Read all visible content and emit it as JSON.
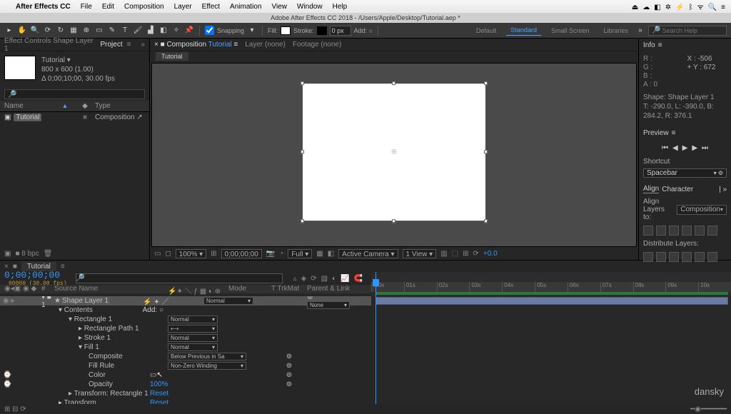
{
  "mac_menu": {
    "app": "After Effects CC",
    "items": [
      "File",
      "Edit",
      "Composition",
      "Layer",
      "Effect",
      "Animation",
      "View",
      "Window",
      "Help"
    ],
    "right": [
      "⏏",
      "☁",
      "◧",
      "⎋",
      "⚡",
      "≡",
      "⏱",
      "✎",
      "🔍",
      "🔊",
      "ᯤ",
      "◧",
      "≡"
    ]
  },
  "window_title": "Adobe After Effects CC 2018 - /Users/Apple/Desktop/Tutorial.aep *",
  "toolbar": {
    "snapping": "Snapping",
    "fill": "Fill:",
    "stroke": "Stroke:",
    "stroke_px": "0 px",
    "add": "Add: ○",
    "workspaces": [
      "Default",
      "Standard",
      "Small Screen",
      "Libraries"
    ],
    "ws_sel": 1,
    "search_ph": "Search Help"
  },
  "project": {
    "tabs": [
      "Effect Controls Shape Layer 1",
      "Project"
    ],
    "active": 1,
    "item_name": "Tutorial ▾",
    "res": "800 x 600 (1.00)",
    "dur": "Δ 0;00;10;00, 30.00 fps",
    "cols": [
      "Name",
      "◆",
      "Type"
    ],
    "row_name": "Tutorial",
    "row_type": "Composition",
    "footer": [
      "▣",
      "■",
      "8 bpc",
      "🗑"
    ]
  },
  "comp": {
    "tabs": [
      "× ■ Composition",
      "Tutorial",
      "Layer (none)",
      "Footage (none)"
    ],
    "comp_name": "Tutorial",
    "footer": {
      "zoom": "100%",
      "res": "Full",
      "time": "0;00;00;00",
      "camera": "Active Camera",
      "view": "1 View",
      "exp": "+0.0"
    }
  },
  "info": {
    "title": "Info",
    "R": "",
    "G": "",
    "B": "",
    "A": "0",
    "X": "-506",
    "Y": "672",
    "shape": "Shape: Shape Layer 1",
    "bounds": "T: -290.0, L: -390.0, B: 284.2, R: 376.1"
  },
  "preview": {
    "title": "Preview",
    "shortcut_lbl": "Shortcut",
    "shortcut": "Spacebar"
  },
  "align": {
    "tabs": [
      "Align",
      "Character"
    ],
    "layers_to": "Align Layers to:",
    "target": "Composition",
    "dist": "Distribute Layers:"
  },
  "timeline": {
    "tab": "Tutorial",
    "time": "0;00;00;00",
    "sub": "00000 (30.00 fps)",
    "cols": {
      "src": "Source Name",
      "mode": "Mode",
      "trk": "T  TrkMat",
      "parent": "Parent & Link"
    },
    "add": "Add: ○",
    "ruler": [
      ":00s",
      "01s",
      "02s",
      "03s",
      "04s",
      "05s",
      "06s",
      "07s",
      "08s",
      "09s",
      "10s"
    ],
    "layer": {
      "num": "1",
      "name": "Shape Layer 1",
      "mode": "Normal",
      "parent": "None"
    },
    "rows": [
      {
        "ind": 1,
        "tw": "▾",
        "name": "Contents",
        "extra": "add"
      },
      {
        "ind": 2,
        "tw": "▾",
        "name": "Rectangle 1",
        "mode": "Normal"
      },
      {
        "ind": 3,
        "tw": "▸",
        "name": "Rectangle Path 1",
        "mode": "⟷"
      },
      {
        "ind": 3,
        "tw": "▸",
        "name": "Stroke 1",
        "mode": "Normal"
      },
      {
        "ind": 3,
        "tw": "▾",
        "name": "Fill 1",
        "mode": "Normal"
      },
      {
        "ind": 4,
        "name": "Composite",
        "val": "Below Previous in Sa",
        "dd": 1,
        "link": 1
      },
      {
        "ind": 4,
        "name": "Fill Rule",
        "val": "Non-Zero Winding",
        "dd": 1,
        "link": 1
      },
      {
        "ind": 4,
        "sw": "⌚",
        "name": "Color",
        "val": "▭",
        "link": 1,
        "cursor": 1
      },
      {
        "ind": 4,
        "sw": "⌚",
        "name": "Opacity",
        "val": "100%",
        "link": 1,
        "blue": 1
      },
      {
        "ind": 2,
        "tw": "▸",
        "name": "Transform: Rectangle 1",
        "val": "Reset",
        "blue": 1
      },
      {
        "ind": 1,
        "tw": "▸",
        "name": "Transform",
        "val": "Reset",
        "blue": 1
      }
    ]
  },
  "brand": "dansky"
}
